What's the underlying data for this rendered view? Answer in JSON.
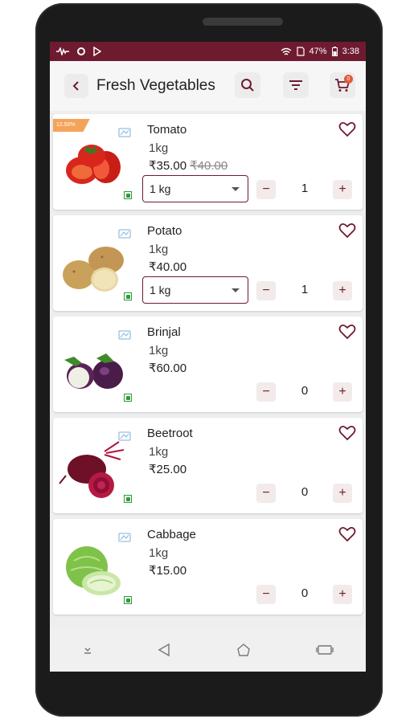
{
  "colors": {
    "primary": "#6e1b30",
    "veg_green": "#2e9b3a",
    "discount_orange": "#f5a35a"
  },
  "status_bar": {
    "battery": "47%",
    "time": "3:38",
    "icons": [
      "wave-icon",
      "record-icon",
      "play-icon",
      "wifi-icon",
      "sim-icon",
      "battery-icon"
    ]
  },
  "header": {
    "title": "Fresh Vegetables",
    "cart_count": "0",
    "icons": [
      "back-icon",
      "search-icon",
      "filter-icon",
      "cart-icon"
    ]
  },
  "products": [
    {
      "name": "Tomato",
      "weight": "1kg",
      "price": "₹35.00",
      "mrp": "₹40.00",
      "discount": "12.50%",
      "has_select": true,
      "select_value": "1 kg",
      "quantity": "1"
    },
    {
      "name": "Potato",
      "weight": "1kg",
      "price": "₹40.00",
      "mrp": "",
      "discount": "",
      "has_select": true,
      "select_value": "1 kg",
      "quantity": "1"
    },
    {
      "name": "Brinjal",
      "weight": "1kg",
      "price": "₹60.00",
      "mrp": "",
      "discount": "",
      "has_select": false,
      "select_value": "",
      "quantity": "0"
    },
    {
      "name": "Beetroot",
      "weight": "1kg",
      "price": "₹25.00",
      "mrp": "",
      "discount": "",
      "has_select": false,
      "select_value": "",
      "quantity": "0"
    },
    {
      "name": "Cabbage",
      "weight": "1kg",
      "price": "₹15.00",
      "mrp": "",
      "discount": "",
      "has_select": false,
      "select_value": "",
      "quantity": "0"
    }
  ],
  "quantity_controls": {
    "minus": "−",
    "plus": "+"
  },
  "nav_bar": {
    "icons": [
      "download-icon",
      "nav-back-icon",
      "home-icon",
      "recents-icon"
    ]
  }
}
